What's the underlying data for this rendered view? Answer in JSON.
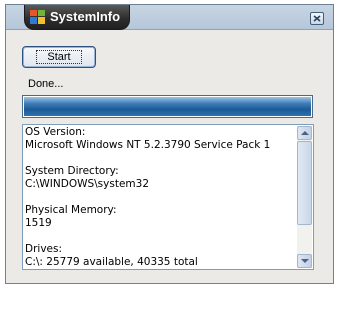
{
  "window": {
    "title": "SystemInfo"
  },
  "controls": {
    "start_label": "Start",
    "status_text": "Done..."
  },
  "progress": {
    "value_percent": 100,
    "fill_color": "#1c5a98"
  },
  "info": {
    "lines": [
      "OS Version:",
      "Microsoft Windows NT 5.2.3790 Service Pack 1",
      "",
      "System Directory:",
      "C:\\WINDOWS\\system32",
      "",
      "Physical Memory:",
      "1519",
      "",
      "Drives:",
      "C:\\: 25779 available, 40335 total"
    ]
  },
  "icons": {
    "app": "windows-flag-icon",
    "close": "close-icon",
    "scroll_up": "scroll-up-arrow-icon",
    "scroll_down": "scroll-down-arrow-icon"
  }
}
